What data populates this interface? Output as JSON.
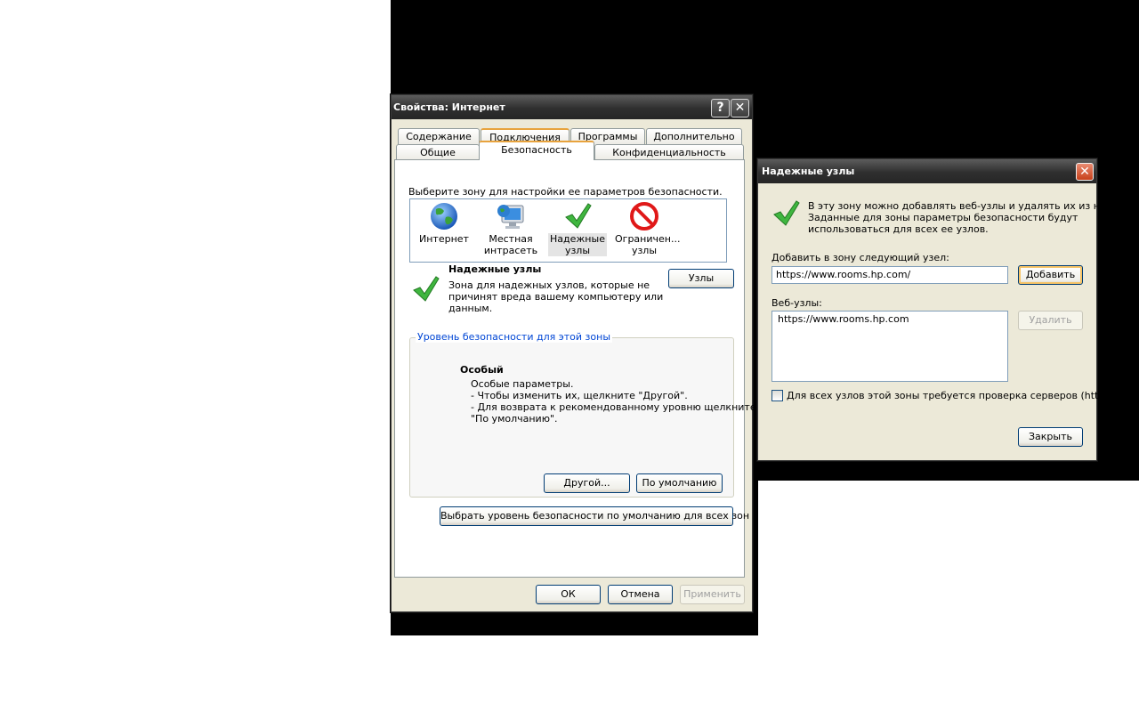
{
  "internet_options": {
    "title": "Свойства: Интернет",
    "help_button": "?",
    "close_button": "✕",
    "tabs_row1": [
      "Содержание",
      "Подключения",
      "Программы",
      "Дополнительно"
    ],
    "tabs_row2": [
      "Общие",
      "Безопасность",
      "Конфиденциальность"
    ],
    "active_tab": "Безопасность",
    "zone_prompt": "Выберите зону для настройки ее параметров безопасности.",
    "zones": [
      {
        "line1": "Интернет",
        "line2": "",
        "icon": "globe-icon"
      },
      {
        "line1": "Местная",
        "line2": "интрасеть",
        "icon": "intranet-monitor-icon"
      },
      {
        "line1": "Надежные",
        "line2": "узлы",
        "icon": "trusted-check-icon"
      },
      {
        "line1": "Ограничен...",
        "line2": "узлы",
        "icon": "restricted-icon"
      }
    ],
    "selected_zone_title": "Надежные узлы",
    "selected_zone_desc_lines": [
      "Зона для надежных узлов, которые не",
      "причинят вреда вашему компьютеру или",
      "данным."
    ],
    "sites_button": "Узлы",
    "security_level_legend": "Уровень безопасности для этой зоны",
    "level_name": "Особый",
    "level_desc_lines": [
      "Особые параметры.",
      "- Чтобы изменить их, щелкните \"Другой\".",
      "- Для возврата к рекомендованному уровню щелкните",
      "\"По умолчанию\"."
    ],
    "custom_button": "Другой...",
    "default_button": "По умолчанию",
    "reset_all_button": "Выбрать уровень безопасности по умолчанию для всех зон",
    "ok_button": "ОК",
    "cancel_button": "Отмена",
    "apply_button": "Применить"
  },
  "trusted_sites": {
    "title": "Надежные узлы",
    "close_button": "✕",
    "info_lines": [
      "В эту зону можно добавлять веб-узлы и удалять их из нее.",
      "Заданные для зоны параметры безопасности будут",
      "использоваться для всех ее узлов."
    ],
    "add_label": "Добавить в зону следующий узел:",
    "add_input_value": "https://www.rooms.hp.com/",
    "add_button": "Добавить",
    "websites_label": "Веб-узлы:",
    "websites": [
      "https://www.rooms.hp.com"
    ],
    "remove_button": "Удалить",
    "require_https_label": "Для всех узлов этой зоны требуется проверка серверов (https:)",
    "close_dialog_button": "Закрыть"
  }
}
